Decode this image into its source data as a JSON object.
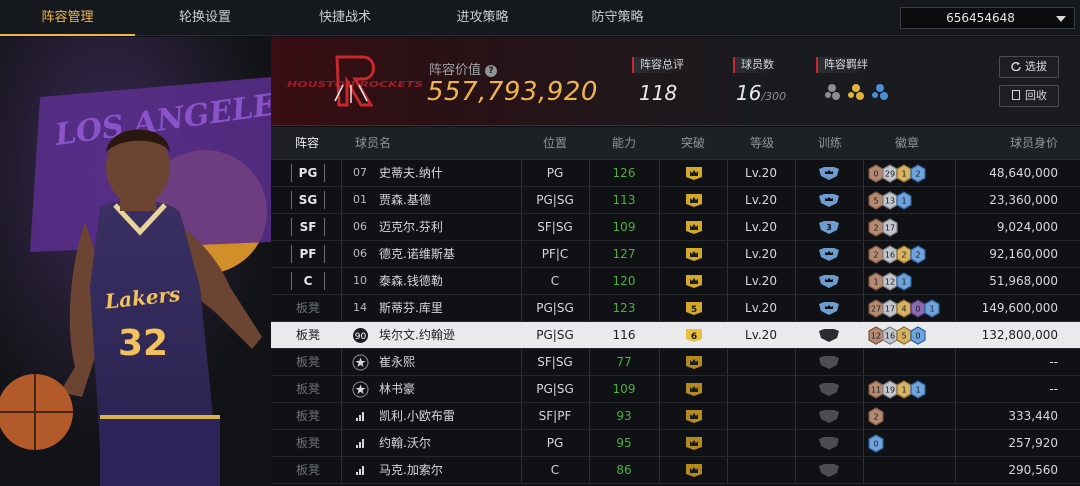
{
  "tabs": [
    {
      "label": "阵容管理",
      "active": true
    },
    {
      "label": "轮换设置",
      "active": false
    },
    {
      "label": "快捷战术",
      "active": false
    },
    {
      "label": "进攻策略",
      "active": false
    },
    {
      "label": "防守策略",
      "active": false
    }
  ],
  "account_id": "656454648",
  "team": {
    "logo_text": "HOUSTON ROCKETS",
    "lineup_value_label": "阵容价值",
    "lineup_value": "557,793,920",
    "rating_label": "阵容总评",
    "rating": "118",
    "players_label": "球员数",
    "players_count": "16",
    "players_max": "/300",
    "bond_label": "阵容羁绊",
    "btn_pick": "选拔",
    "btn_recycle": "回收"
  },
  "art_text": "LOS ANGELES LAKERS",
  "jersey": {
    "team": "Lakers",
    "number": "32"
  },
  "columns": {
    "lineup": "阵容",
    "name": "球员名",
    "position": "位置",
    "ability": "能力",
    "breakthrough": "突破",
    "level": "等级",
    "training": "训练",
    "badges": "徽章",
    "value": "球员身价"
  },
  "rows": [
    {
      "slot": "PG",
      "starter": true,
      "num": "07",
      "name": "史蒂夫.纳什",
      "position": "PG",
      "ability": "126",
      "crown": "",
      "level": "Lv.20",
      "train": "",
      "badges": [
        [
          "0",
          "bronze"
        ],
        [
          "29",
          "silver"
        ],
        [
          "1",
          "gold"
        ],
        [
          "2",
          "blue"
        ]
      ],
      "value": "48,640,000"
    },
    {
      "slot": "SG",
      "starter": true,
      "num": "01",
      "name": "贾森.基德",
      "position": "PG|SG",
      "ability": "113",
      "crown": "",
      "level": "Lv.20",
      "train": "",
      "badges": [
        [
          "5",
          "bronze"
        ],
        [
          "13",
          "silver"
        ],
        [
          "1",
          "blue"
        ]
      ],
      "value": "23,360,000"
    },
    {
      "slot": "SF",
      "starter": true,
      "num": "06",
      "name": "迈克尔.芬利",
      "position": "SF|SG",
      "ability": "109",
      "crown": "",
      "level": "Lv.20",
      "train": "3",
      "badges": [
        [
          "2",
          "bronze"
        ],
        [
          "17",
          "silver"
        ]
      ],
      "value": "9,024,000"
    },
    {
      "slot": "PF",
      "starter": true,
      "num": "06",
      "name": "德克.诺维斯基",
      "position": "PF|C",
      "ability": "127",
      "crown": "",
      "level": "Lv.20",
      "train": "",
      "badges": [
        [
          "2",
          "bronze"
        ],
        [
          "16",
          "silver"
        ],
        [
          "2",
          "gold"
        ],
        [
          "2",
          "blue"
        ]
      ],
      "value": "92,160,000"
    },
    {
      "slot": "C",
      "starter": true,
      "num": "10",
      "name": "泰森.钱德勒",
      "position": "C",
      "ability": "120",
      "crown": "",
      "level": "Lv.20",
      "train": "",
      "badges": [
        [
          "1",
          "bronze"
        ],
        [
          "12",
          "silver"
        ],
        [
          "1",
          "blue"
        ]
      ],
      "value": "51,968,000"
    },
    {
      "slot": "板凳",
      "starter": false,
      "num": "14",
      "name": "斯蒂芬.库里",
      "position": "PG|SG",
      "ability": "123",
      "crown": "5",
      "level": "Lv.20",
      "train": "",
      "badges": [
        [
          "27",
          "bronze"
        ],
        [
          "17",
          "silver"
        ],
        [
          "4",
          "gold"
        ],
        [
          "0",
          "purple"
        ],
        [
          "1",
          "blue"
        ]
      ],
      "value": "149,600,000"
    },
    {
      "slot": "板凳",
      "starter": false,
      "num": "90",
      "name": "埃尔文.约翰逊",
      "position": "PG|SG",
      "ability": "116",
      "crown": "6",
      "level": "Lv.20",
      "train": "",
      "badges": [
        [
          "12",
          "bronze"
        ],
        [
          "16",
          "silver"
        ],
        [
          "5",
          "gold"
        ],
        [
          "0",
          "blue"
        ]
      ],
      "value": "132,800,000",
      "selected": true
    },
    {
      "slot": "板凳",
      "starter": false,
      "num": "",
      "name": "崔永熙",
      "position": "SF|SG",
      "ability": "77",
      "crown": "",
      "level": "",
      "train": "",
      "badges": [],
      "value": "--"
    },
    {
      "slot": "板凳",
      "starter": false,
      "num": "",
      "name": "林书豪",
      "position": "PG|SG",
      "ability": "109",
      "crown": "",
      "level": "",
      "train": "",
      "badges": [
        [
          "11",
          "bronze"
        ],
        [
          "19",
          "silver"
        ],
        [
          "1",
          "gold"
        ],
        [
          "1",
          "blue"
        ]
      ],
      "value": "--"
    },
    {
      "slot": "板凳",
      "starter": false,
      "num": "",
      "name": "凯利.小欧布雷",
      "position": "SF|PF",
      "ability": "93",
      "crown": "",
      "level": "",
      "train": "",
      "badges": [
        [
          "2",
          "bronze"
        ]
      ],
      "value": "333,440"
    },
    {
      "slot": "板凳",
      "starter": false,
      "num": "",
      "name": "约翰.沃尔",
      "position": "PG",
      "ability": "95",
      "crown": "",
      "level": "",
      "train": "",
      "badges": [
        [
          "0",
          "blue"
        ]
      ],
      "value": "257,920"
    },
    {
      "slot": "板凳",
      "starter": false,
      "num": "",
      "name": "马克.加索尔",
      "position": "C",
      "ability": "86",
      "crown": "",
      "level": "",
      "train": "",
      "badges": [],
      "value": "290,560"
    }
  ]
}
